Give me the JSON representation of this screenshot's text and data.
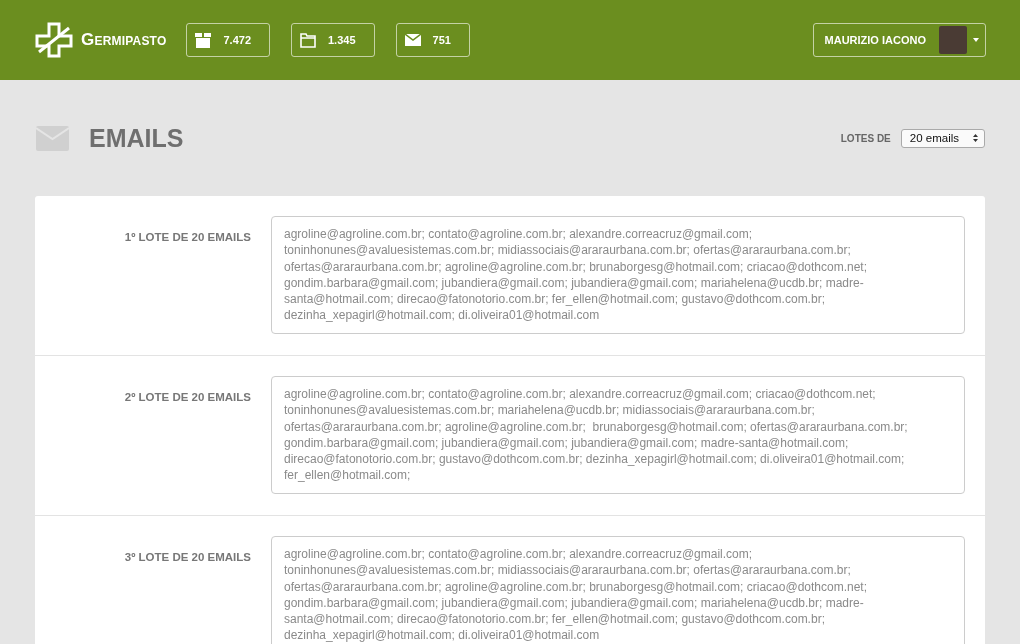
{
  "header": {
    "logo": "Germipasto",
    "stats": [
      {
        "kind": "box",
        "value": "7.472"
      },
      {
        "kind": "folder",
        "value": "1.345"
      },
      {
        "kind": "mail",
        "value": "751"
      }
    ],
    "user": {
      "name": "MAURIZIO IACONO"
    }
  },
  "page": {
    "title": "EMAILS",
    "batch_size": {
      "label": "LOTES DE",
      "value": "20 emails"
    }
  },
  "batches": [
    {
      "label": "1º LOTE DE 20 EMAILS",
      "emails": "agroline@agroline.com.br; contato@agroline.com.br; alexandre.correacruz@gmail.com; toninhonunes@avaluesistemas.com.br; midiassociais@araraurbana.com.br; ofertas@araraurbana.com.br; ofertas@araraurbana.com.br; agroline@agroline.com.br; brunaborgesg@hotmail.com; criacao@dothcom.net; gondim.barbara@gmail.com; jubandiera@gmail.com; jubandiera@gmail.com; mariahelena@ucdb.br; madre-santa@hotmail.com; direcao@fatonotorio.com.br; fer_ellen@hotmail.com; gustavo@dothcom.com.br; dezinha_xepagirl@hotmail.com; di.oliveira01@hotmail.com"
    },
    {
      "label": "2º LOTE DE 20 EMAILS",
      "emails": "agroline@agroline.com.br; contato@agroline.com.br; alexandre.correacruz@gmail.com; criacao@dothcom.net; toninhonunes@avaluesistemas.com.br; mariahelena@ucdb.br; midiassociais@araraurbana.com.br; ofertas@araraurbana.com.br; agroline@agroline.com.br;  brunaborgesg@hotmail.com; ofertas@araraurbana.com.br; gondim.barbara@gmail.com; jubandiera@gmail.com; jubandiera@gmail.com; madre-santa@hotmail.com; direcao@fatonotorio.com.br; gustavo@dothcom.com.br; dezinha_xepagirl@hotmail.com; di.oliveira01@hotmail.com; fer_ellen@hotmail.com;"
    },
    {
      "label": "3º LOTE DE 20 EMAILS",
      "emails": "agroline@agroline.com.br; contato@agroline.com.br; alexandre.correacruz@gmail.com; toninhonunes@avaluesistemas.com.br; midiassociais@araraurbana.com.br; ofertas@araraurbana.com.br; ofertas@araraurbana.com.br; agroline@agroline.com.br; brunaborgesg@hotmail.com; criacao@dothcom.net; gondim.barbara@gmail.com; jubandiera@gmail.com; jubandiera@gmail.com; mariahelena@ucdb.br; madre-santa@hotmail.com; direcao@fatonotorio.com.br; fer_ellen@hotmail.com; gustavo@dothcom.com.br; dezinha_xepagirl@hotmail.com; di.oliveira01@hotmail.com"
    }
  ]
}
